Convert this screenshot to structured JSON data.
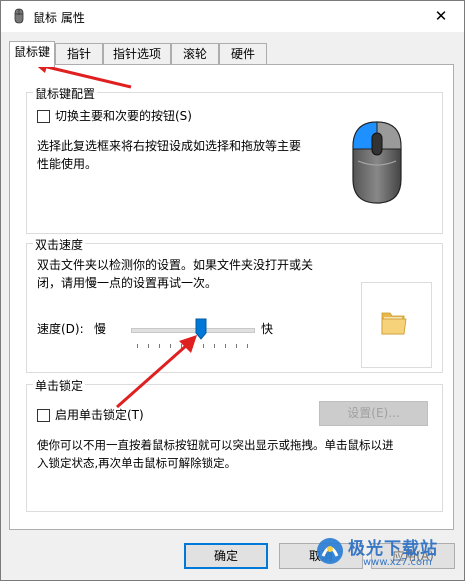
{
  "window": {
    "title": "鼠标 属性",
    "close_glyph": "✕"
  },
  "tabs": [
    {
      "label": "鼠标键",
      "active": true
    },
    {
      "label": "指针"
    },
    {
      "label": "指针选项"
    },
    {
      "label": "滚轮"
    },
    {
      "label": "硬件"
    }
  ],
  "button_config": {
    "title": "鼠标键配置",
    "checkbox_label": "切换主要和次要的按钮(S)",
    "checked": false,
    "description_line1": "选择此复选框来将右按钮设成如选择和拖放等主要",
    "description_line2": "性能使用。"
  },
  "double_click": {
    "title": "双击速度",
    "description_line1": "双击文件夹以检测你的设置。如果文件夹没打开或关",
    "description_line2": "闭，请用慢一点的设置再试一次。",
    "speed_label": "速度(D):",
    "slow_label": "慢",
    "fast_label": "快",
    "speed_value": 0.58
  },
  "click_lock": {
    "title": "单击锁定",
    "checkbox_label": "启用单击锁定(T)",
    "checked": false,
    "settings_button": "设置(E)...",
    "description_line1": "使你可以不用一直按着鼠标按钮就可以突出显示或拖拽。单击鼠标以进",
    "description_line2": "入锁定状态,再次单击鼠标可解除锁定。"
  },
  "footer": {
    "ok": "确定",
    "cancel": "取消",
    "apply": "应用(A)"
  },
  "watermark": {
    "text": "极光下载站",
    "url": "www.xz7.com"
  },
  "colors": {
    "accent": "#0078d7",
    "annotation_arrow": "#e02020"
  }
}
